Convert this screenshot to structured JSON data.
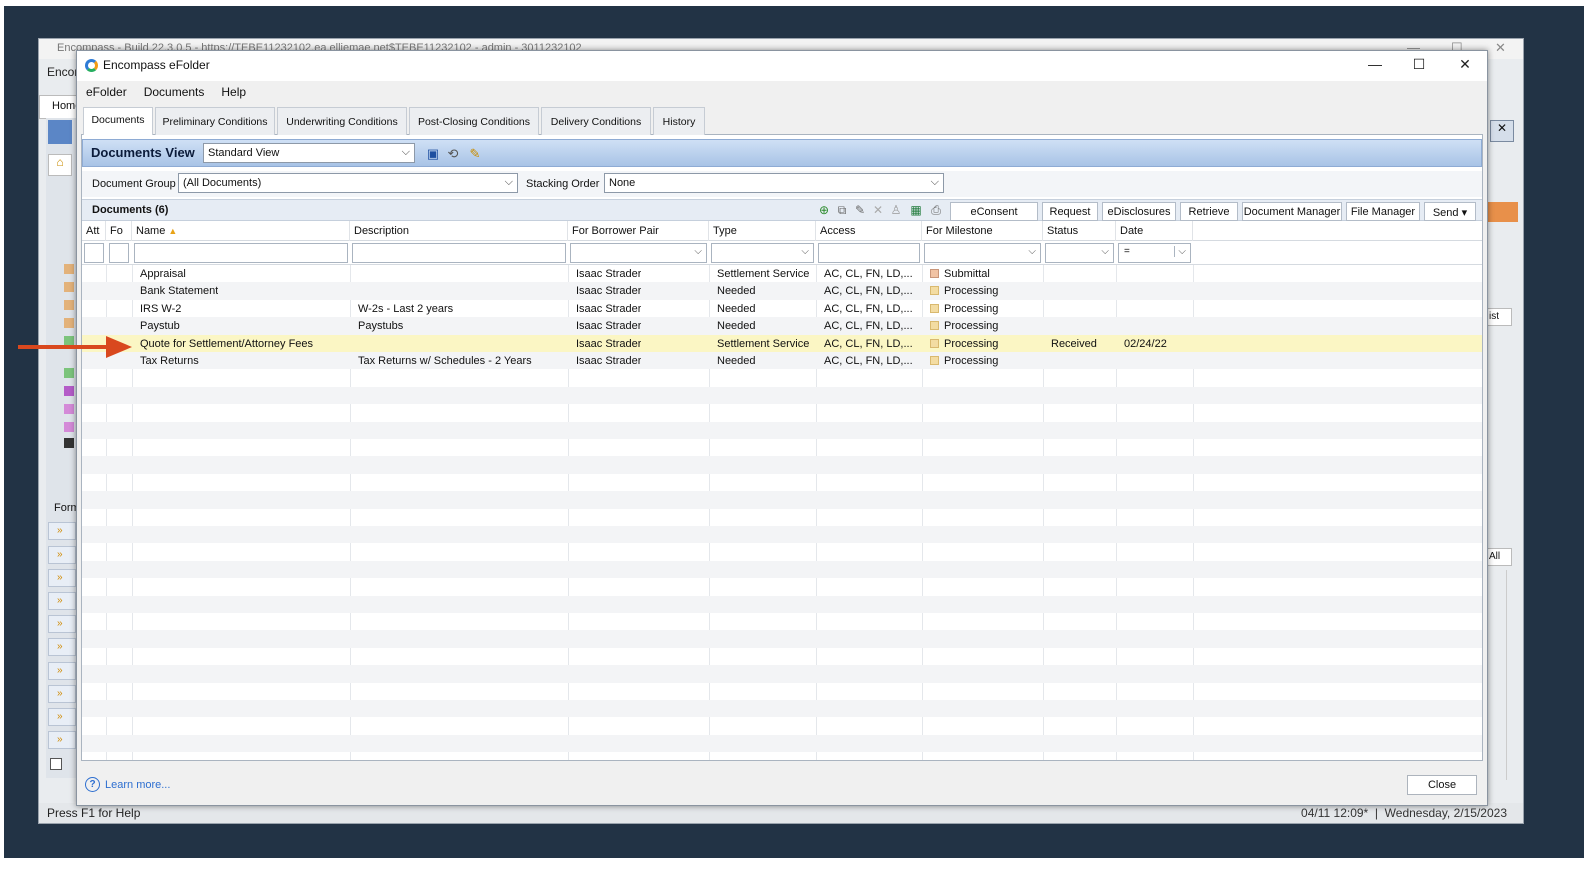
{
  "background_window": {
    "title": "Encompass - Build 22.3.0.5 - https://TEBE11232102.ea.elliemae.net$TEBE11232102 - admin - 3011232102",
    "menu_label": "Encor",
    "home_tab": "Home",
    "forms_label": "Form",
    "right_button_1": "ist",
    "right_button_2": "All",
    "status_text": "Press F1 for Help",
    "status_time": "04/11 12:09*",
    "status_date": "Wednesday, 2/15/2023"
  },
  "dialog": {
    "title": "Encompass eFolder",
    "minimize_glyph": "—",
    "maximize_glyph": "☐",
    "close_glyph": "✕",
    "menu": [
      "eFolder",
      "Documents",
      "Help"
    ],
    "tabs": [
      "Documents",
      "Preliminary Conditions",
      "Underwriting Conditions",
      "Post-Closing Conditions",
      "Delivery Conditions",
      "History"
    ],
    "active_tab": "Documents",
    "view_label": "Documents View",
    "view_value": "Standard View",
    "document_group_label": "Document Group",
    "document_group_value": "(All Documents)",
    "stacking_order_label": "Stacking Order",
    "stacking_order_value": "None",
    "documents_count_label": "Documents (6)",
    "toolbar_buttons": [
      "eConsent",
      "Request",
      "eDisclosures",
      "Retrieve",
      "Document Manager",
      "File Manager",
      "Send"
    ],
    "columns": [
      "Att",
      "Fo",
      "Name",
      "Description",
      "For Borrower Pair",
      "Type",
      "Access",
      "For Milestone",
      "Status",
      "Date"
    ],
    "sort_indicator": "▲",
    "date_filter_operator": "=",
    "rows": [
      {
        "name": "Appraisal",
        "description": "",
        "borrower": "Isaac Strader",
        "type": "Settlement Service",
        "access": "AC, CL, FN, LD,...",
        "milestone": "Submittal",
        "status": "",
        "date": ""
      },
      {
        "name": "Bank Statement",
        "description": "",
        "borrower": "Isaac Strader",
        "type": "Needed",
        "access": "AC, CL, FN, LD,...",
        "milestone": "Processing",
        "status": "",
        "date": ""
      },
      {
        "name": "IRS W-2",
        "description": "W-2s - Last 2 years",
        "borrower": "Isaac Strader",
        "type": "Needed",
        "access": "AC, CL, FN, LD,...",
        "milestone": "Processing",
        "status": "",
        "date": ""
      },
      {
        "name": "Paystub",
        "description": "Paystubs",
        "borrower": "Isaac Strader",
        "type": "Needed",
        "access": "AC, CL, FN, LD,...",
        "milestone": "Processing",
        "status": "",
        "date": ""
      },
      {
        "name": "Quote for Settlement/Attorney Fees",
        "description": "",
        "borrower": "Isaac Strader",
        "type": "Settlement Service",
        "access": "AC, CL, FN, LD,...",
        "milestone": "Processing",
        "status": "Received",
        "date": "02/24/22"
      },
      {
        "name": "Tax Returns",
        "description": "Tax Returns w/ Schedules - 2 Years",
        "borrower": "Isaac Strader",
        "type": "Needed",
        "access": "AC, CL, FN, LD,...",
        "milestone": "Processing",
        "status": "",
        "date": ""
      }
    ],
    "highlighted_row_index": 4,
    "learn_more": "Learn more...",
    "close_button": "Close"
  },
  "colors": {
    "backdrop": "#223345",
    "highlight_row": "#fbf6c4",
    "arrow": "#d9481e",
    "view_bar": "#a8c3e6"
  }
}
